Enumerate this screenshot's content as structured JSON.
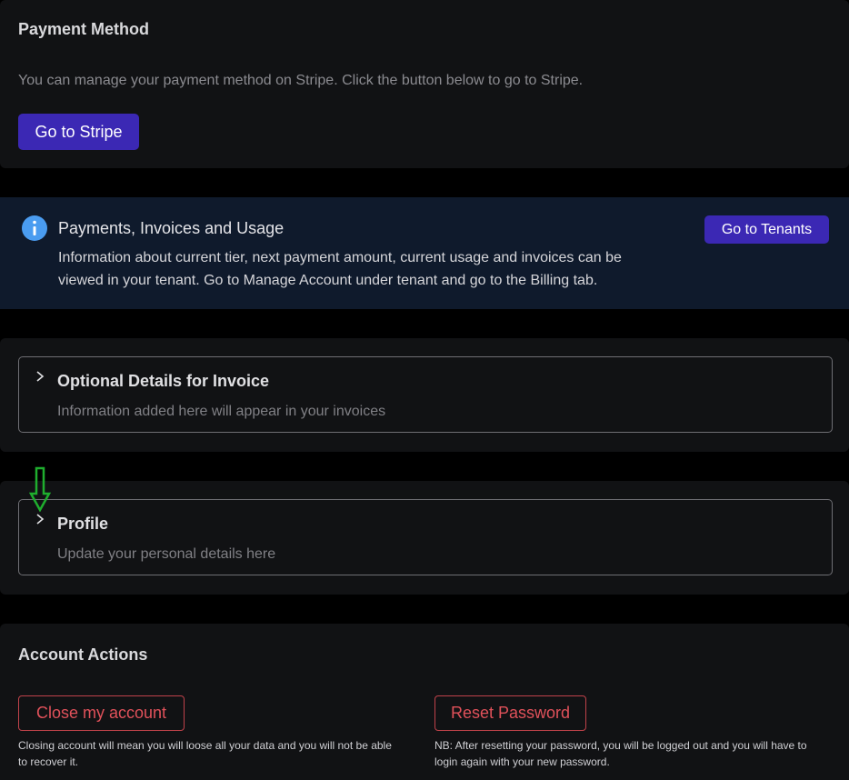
{
  "payment_method": {
    "title": "Payment Method",
    "description": "You can manage your payment method on Stripe. Click the button below to go to Stripe.",
    "button_label": "Go to Stripe"
  },
  "info_banner": {
    "icon": "info-icon",
    "title": "Payments, Invoices and Usage",
    "line1": "Information about current tier, next payment amount, current usage and invoices can be",
    "line2": "viewed in your tenant. Go to Manage Account under tenant and go to the Billing tab.",
    "button_label": "Go to Tenants",
    "background_color": "#0f1a2c",
    "icon_color": "#4a9cf0"
  },
  "optional_details": {
    "title": "Optional Details for Invoice",
    "subtitle": "Information added here will appear in your invoices",
    "icon": "chevron-right-icon"
  },
  "profile": {
    "title": "Profile",
    "subtitle": "Update your personal details here",
    "icon": "chevron-right-icon",
    "annotation_icon": "down-arrow-icon",
    "annotation_color": "#1fae2e"
  },
  "account_actions": {
    "title": "Account Actions",
    "close_button_label": "Close my account",
    "close_note_line1": "Closing account will mean you will loose all your data and you will not be able",
    "close_note_line2": "to recover it.",
    "reset_button_label": "Reset Password",
    "reset_note_line1": "NB: After resetting your password, you will be logged out and you will have to",
    "reset_note_line2": "login again with your new password."
  },
  "colors": {
    "primary_button": "#3b28b4",
    "danger": "#e0515a",
    "card_background": "#111214",
    "page_background": "#000000"
  }
}
